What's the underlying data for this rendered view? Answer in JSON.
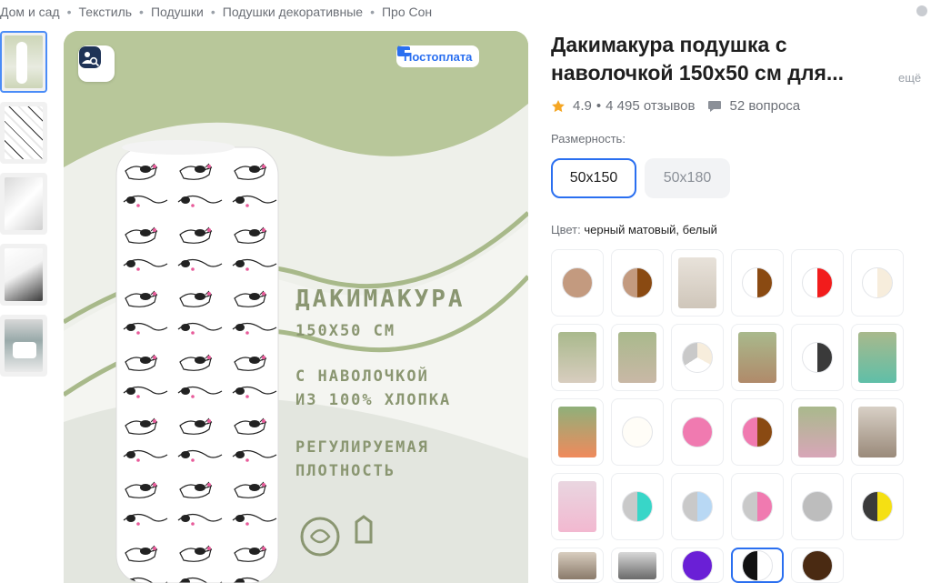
{
  "breadcrumb": [
    "Дом и сад",
    "Текстиль",
    "Подушки",
    "Подушки декоративные",
    "Про Сон"
  ],
  "icons": {
    "search": "image-search-icon",
    "postpay": "wallet-icon",
    "chevron": "chevron-right-icon",
    "star": "star-icon",
    "question": "question-bubble-icon",
    "corner": "circle-icon"
  },
  "gallery": {
    "postpay_label": "Постоплата",
    "promo_title": "ДАКИМАКУРА",
    "promo_size": "150Х50 СМ",
    "promo_line1": "С НАВОЛОЧКОЙ",
    "promo_line2": "ИЗ 100% ХЛОПКА",
    "promo_line3": "РЕГУЛИРУЕМАЯ",
    "promo_line4": "ПЛОТНОСТЬ",
    "thumbnails": [
      "thumb-1",
      "thumb-2",
      "thumb-3",
      "thumb-4",
      "thumb-5"
    ]
  },
  "product": {
    "title": "Дакимакура подушка с наволочкой 150х50 см для...",
    "more": "ещё",
    "rating": "4.9",
    "reviews": "4 495 отзывов",
    "questions": "52 вопроса"
  },
  "size": {
    "label": "Размерность:",
    "options": [
      "50x150",
      "50x180"
    ],
    "selected": "50x150"
  },
  "color": {
    "label": "Цвет:",
    "value": "черный матовый, белый"
  },
  "colors": {
    "accent": "#2a6ff0",
    "star": "#f5a623",
    "promo_bg": "#b8c79a",
    "promo_text": "#8a9671"
  }
}
